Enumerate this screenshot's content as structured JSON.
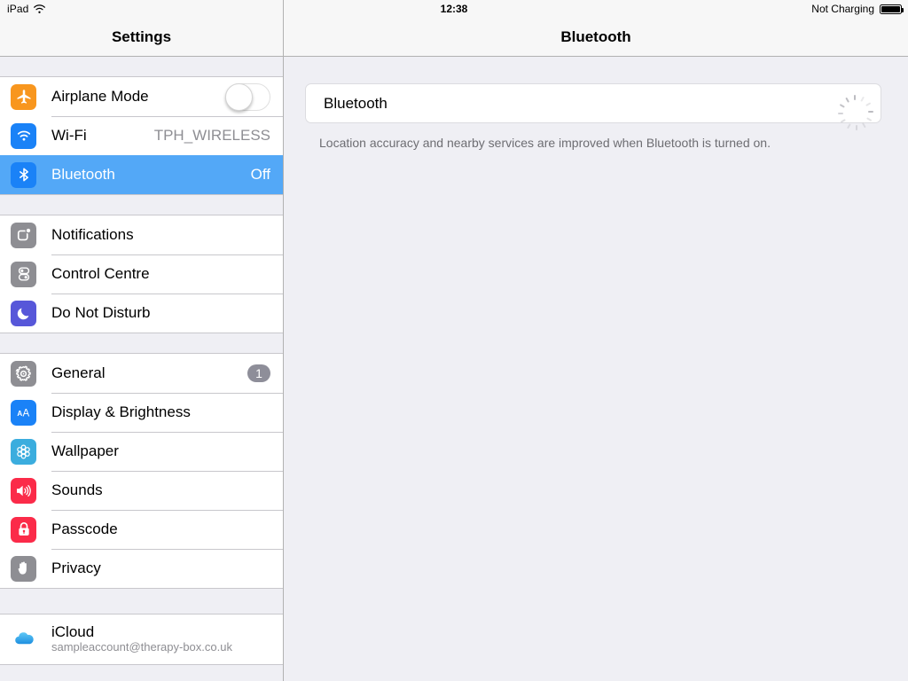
{
  "status_bar": {
    "device": "iPad",
    "wifi_icon": "wifi-icon",
    "time": "12:38",
    "battery_text": "Not Charging",
    "battery_icon": "battery-full-icon",
    "battery_level_percent": 100
  },
  "sidebar": {
    "title": "Settings",
    "groups": [
      {
        "name": "connectivity",
        "items": [
          {
            "label": "Airplane Mode",
            "icon": "airplane-icon",
            "icon_color": "#F8961E",
            "accessory": "toggle",
            "toggle_on": false
          },
          {
            "label": "Wi-Fi",
            "icon": "wifi-icon",
            "icon_color": "#1A82F7",
            "accessory": "value",
            "value": "TPH_WIRELESS"
          },
          {
            "label": "Bluetooth",
            "icon": "bluetooth-icon",
            "icon_color": "#1A82F7",
            "accessory": "value",
            "value": "Off",
            "selected": true
          }
        ]
      },
      {
        "name": "notifications",
        "items": [
          {
            "label": "Notifications",
            "icon": "notifications-icon",
            "icon_color": "#8E8E93",
            "accessory": "none"
          },
          {
            "label": "Control Centre",
            "icon": "control-centre-icon",
            "icon_color": "#8E8E93",
            "accessory": "none"
          },
          {
            "label": "Do Not Disturb",
            "icon": "moon-icon",
            "icon_color": "#5757D9",
            "accessory": "none"
          }
        ]
      },
      {
        "name": "system",
        "items": [
          {
            "label": "General",
            "icon": "gear-icon",
            "icon_color": "#8E8E93",
            "accessory": "badge",
            "badge": "1"
          },
          {
            "label": "Display & Brightness",
            "icon": "display-brightness-icon",
            "icon_color": "#1A82F7",
            "accessory": "none"
          },
          {
            "label": "Wallpaper",
            "icon": "wallpaper-icon",
            "icon_color": "#3BADDE",
            "accessory": "none"
          },
          {
            "label": "Sounds",
            "icon": "speaker-icon",
            "icon_color": "#FB2B49",
            "accessory": "none"
          },
          {
            "label": "Passcode",
            "icon": "lock-icon",
            "icon_color": "#FB2B49",
            "accessory": "none"
          },
          {
            "label": "Privacy",
            "icon": "hand-icon",
            "icon_color": "#8E8E93",
            "accessory": "none"
          }
        ]
      },
      {
        "name": "accounts",
        "items": [
          {
            "label": "iCloud",
            "sub": "sampleaccount@therapy-box.co.uk",
            "icon": "icloud-icon",
            "icon_color": "#FFFFFF",
            "accessory": "none"
          }
        ]
      }
    ]
  },
  "detail": {
    "title": "Bluetooth",
    "card": {
      "label": "Bluetooth",
      "accessory": "spinner"
    },
    "footnote": "Location accuracy and nearby services are improved when Bluetooth is turned on."
  },
  "colors": {
    "selection_blue": "#53A8F7",
    "chrome_gray": "#EFEFF4",
    "separator": "#C8C7CC",
    "secondary_text": "#8E8E93"
  }
}
